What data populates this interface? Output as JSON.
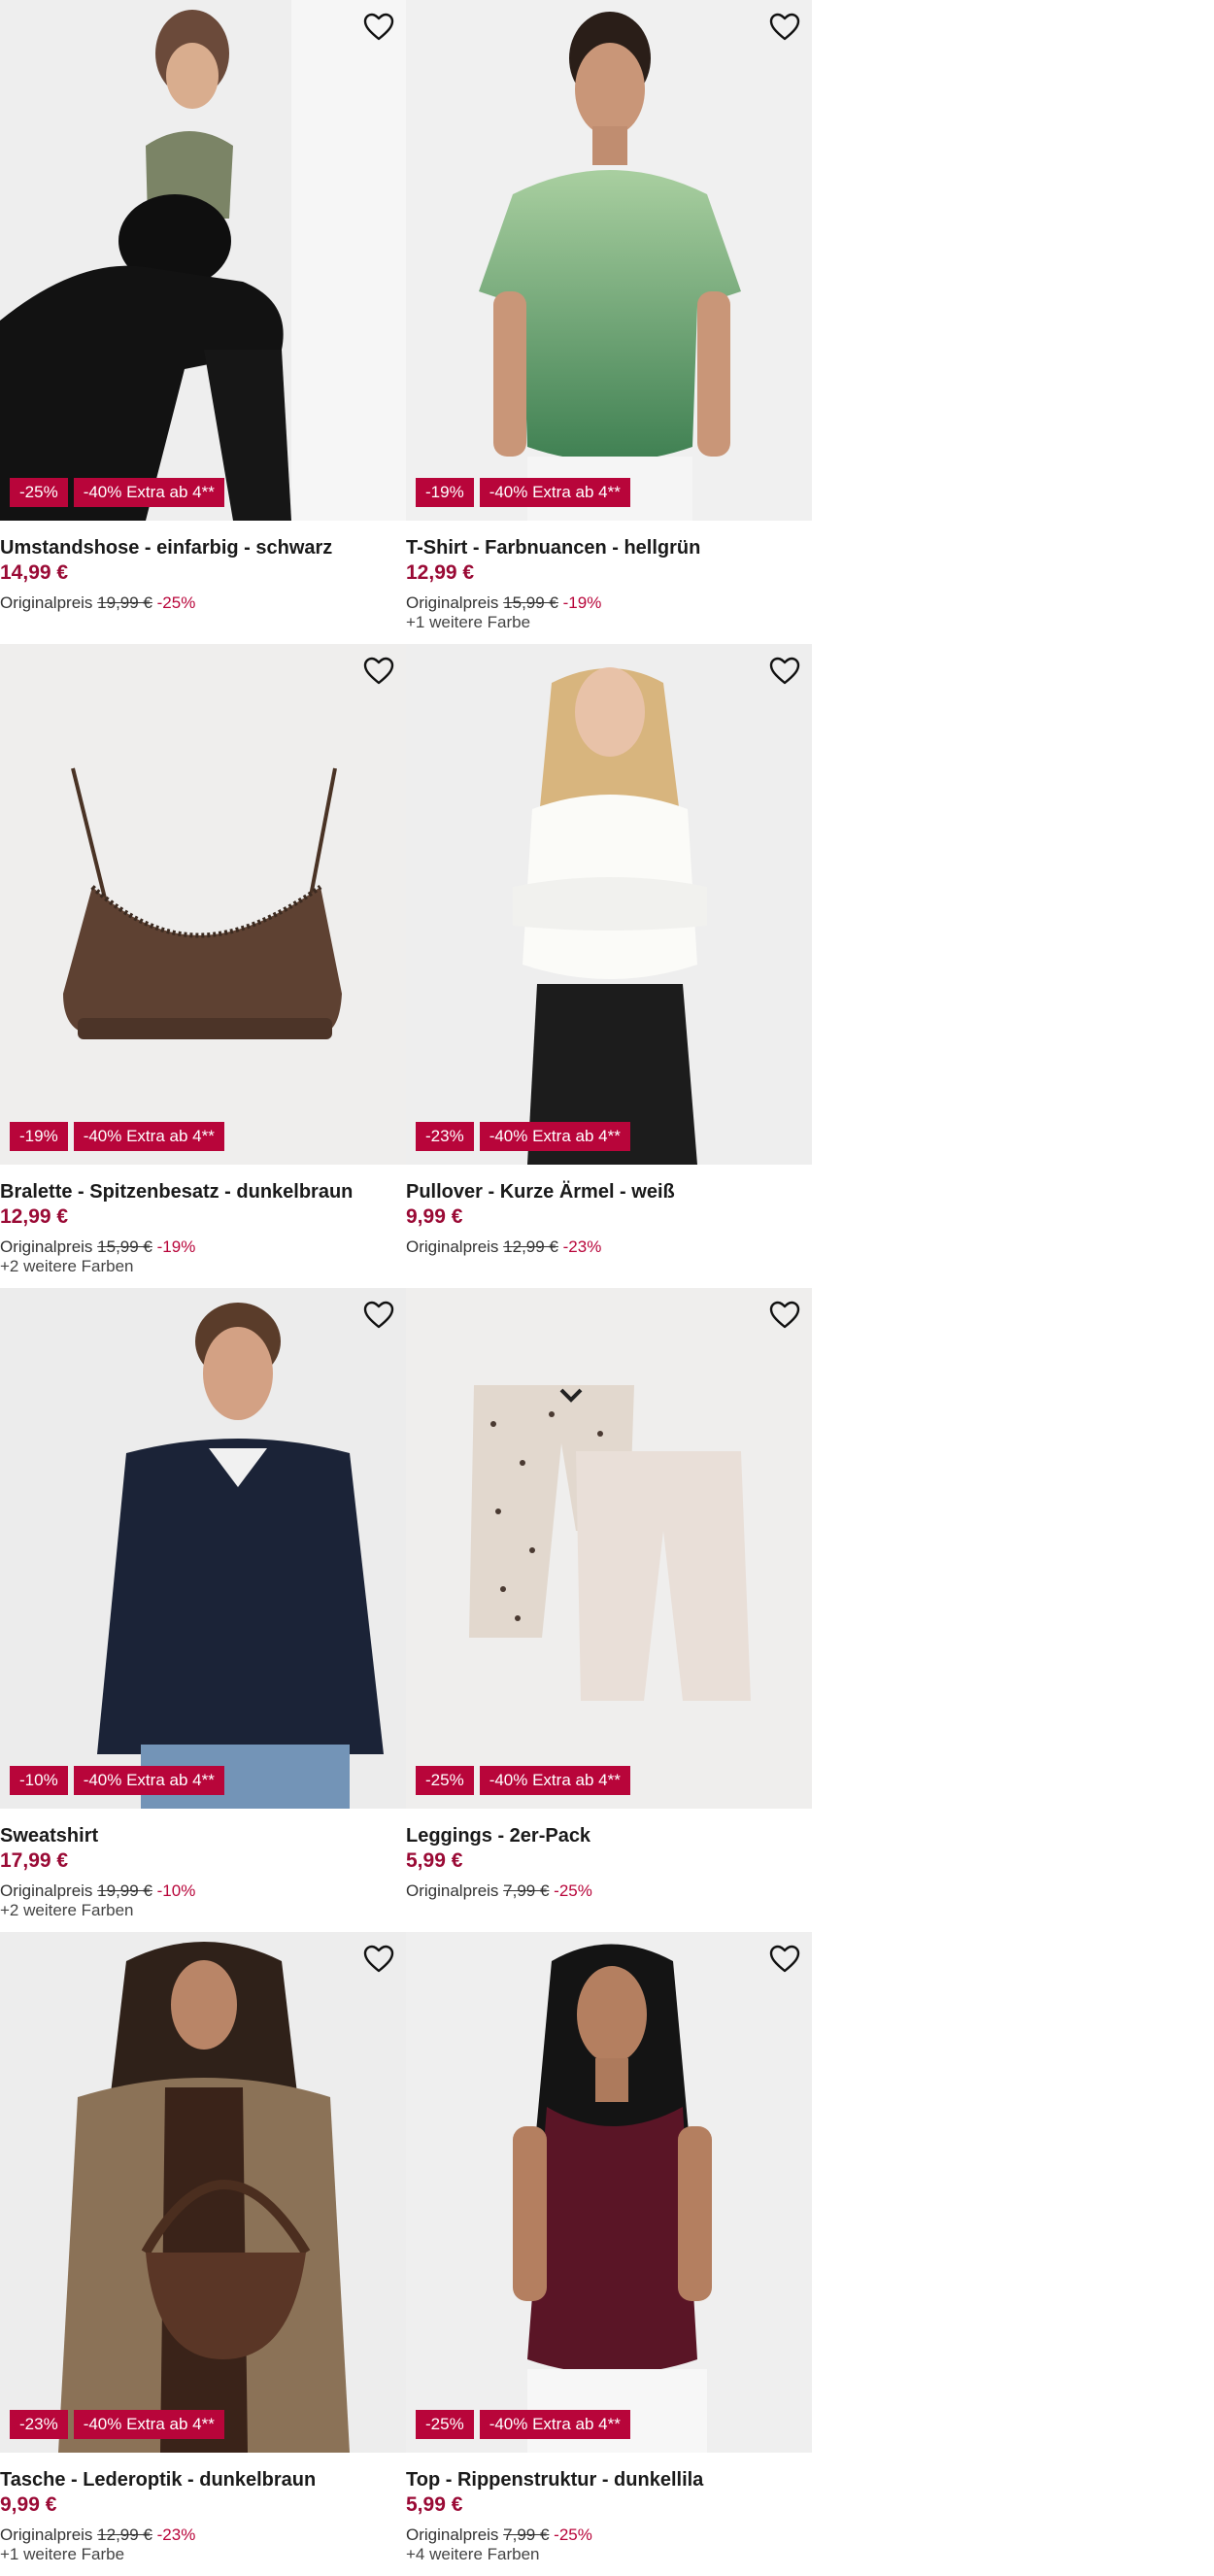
{
  "badge_extra": "-40% Extra ab 4**",
  "original_label": "Originalpreis",
  "products": [
    {
      "name": "Umstandshose - einfarbig - schwarz",
      "price": "14,99 €",
      "original": "19,99 €",
      "discount": "-25%",
      "colors": ""
    },
    {
      "name": "T-Shirt - Farbnuancen - hellgrün",
      "price": "12,99 €",
      "original": "15,99 €",
      "discount": "-19%",
      "colors": "+1 weitere Farbe"
    },
    {
      "name": "Bralette - Spitzenbesatz - dunkelbraun",
      "price": "12,99 €",
      "original": "15,99 €",
      "discount": "-19%",
      "colors": "+2 weitere Farben"
    },
    {
      "name": "Pullover - Kurze Ärmel - weiß",
      "price": "9,99 €",
      "original": "12,99 €",
      "discount": "-23%",
      "colors": ""
    },
    {
      "name": "Sweatshirt",
      "price": "17,99 €",
      "original": "19,99 €",
      "discount": "-10%",
      "colors": "+2 weitere Farben"
    },
    {
      "name": "Leggings - 2er-Pack",
      "price": "5,99 €",
      "original": "7,99 €",
      "discount": "-25%",
      "colors": ""
    },
    {
      "name": "Tasche - Lederoptik - dunkelbraun",
      "price": "9,99 €",
      "original": "12,99 €",
      "discount": "-23%",
      "colors": "+1 weitere Farbe"
    },
    {
      "name": "Top - Rippenstruktur - dunkellila",
      "price": "5,99 €",
      "original": "7,99 €",
      "discount": "-25%",
      "colors": "+4 weitere Farben"
    }
  ],
  "colors": {
    "badge": "#b8053a",
    "price": "#9a0a35"
  },
  "icons": {
    "favorite": "heart-outline-icon"
  }
}
